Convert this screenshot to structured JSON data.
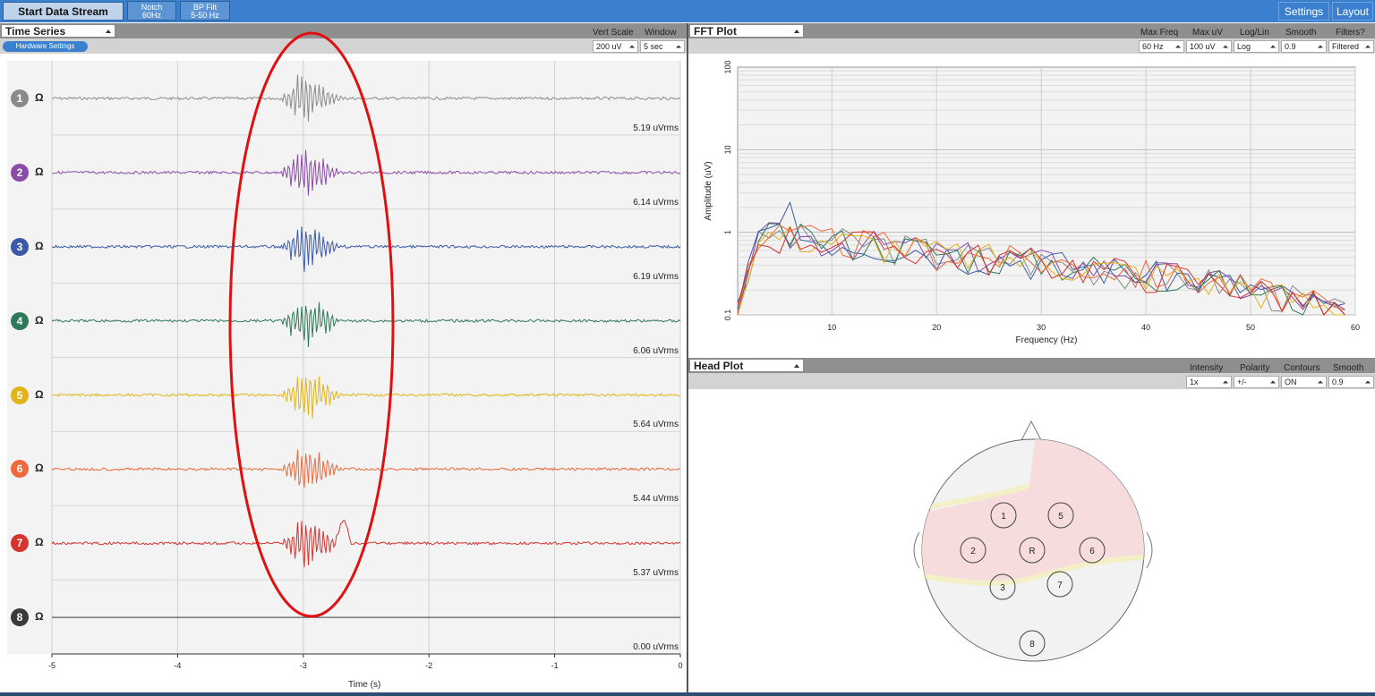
{
  "toolbar": {
    "start_label": "Start Data Stream",
    "notch_line1": "Notch",
    "notch_line2": "60Hz",
    "bp_line1": "BP Filt",
    "bp_line2": "5-50 Hz",
    "settings_label": "Settings",
    "layout_label": "Layout"
  },
  "time_series": {
    "title": "Time Series",
    "hardware_settings": "Hardware Settings",
    "vert_scale_label": "Vert Scale",
    "vert_scale_value": "200 uV",
    "window_label": "Window",
    "window_value": "5 sec",
    "channels": [
      {
        "num": "1",
        "rms": "5.19 uVrms",
        "color": "#8a8a8a"
      },
      {
        "num": "2",
        "rms": "6.14 uVrms",
        "color": "#8b4ba8"
      },
      {
        "num": "3",
        "rms": "6.19 uVrms",
        "color": "#3a5aa8"
      },
      {
        "num": "4",
        "rms": "6.06 uVrms",
        "color": "#2e7a58"
      },
      {
        "num": "5",
        "rms": "5.64 uVrms",
        "color": "#e2b417"
      },
      {
        "num": "6",
        "rms": "5.44 uVrms",
        "color": "#ee6a3c"
      },
      {
        "num": "7",
        "rms": "5.37 uVrms",
        "color": "#d6332f"
      },
      {
        "num": "8",
        "rms": "0.00 uVrms",
        "color": "#3b3b3b"
      }
    ],
    "impedance_symbol": "Ω",
    "x_ticks": [
      "-5",
      "-4",
      "-3",
      "-2",
      "-1",
      "0"
    ],
    "x_title": "Time (s)"
  },
  "fft": {
    "title": "FFT Plot",
    "max_freq_label": "Max Freq",
    "max_freq_value": "60 Hz",
    "max_uv_label": "Max uV",
    "max_uv_value": "100 uV",
    "loglin_label": "Log/Lin",
    "loglin_value": "Log",
    "smooth_label": "Smooth",
    "smooth_value": "0.9",
    "filters_label": "Filters?",
    "filters_value": "Filtered",
    "y_title": "Amplitude (uV)",
    "x_title": "Frequency (Hz)",
    "x_ticks": [
      "10",
      "20",
      "30",
      "40",
      "50",
      "60"
    ],
    "y_ticks": [
      "100",
      "10",
      "1",
      "0.1"
    ]
  },
  "head_plot": {
    "title": "Head Plot",
    "intensity_label": "Intensity",
    "intensity_value": "1x",
    "polarity_label": "Polarity",
    "polarity_value": "+/-",
    "contours_label": "Contours",
    "contours_value": "ON",
    "smooth_label": "Smooth",
    "smooth_value": "0.9",
    "electrodes": [
      "1",
      "5",
      "2",
      "R",
      "6",
      "3",
      "7",
      "8"
    ]
  },
  "colors": {
    "toolbar_blue": "#3a80cf",
    "highlight_red": "#e01010"
  }
}
